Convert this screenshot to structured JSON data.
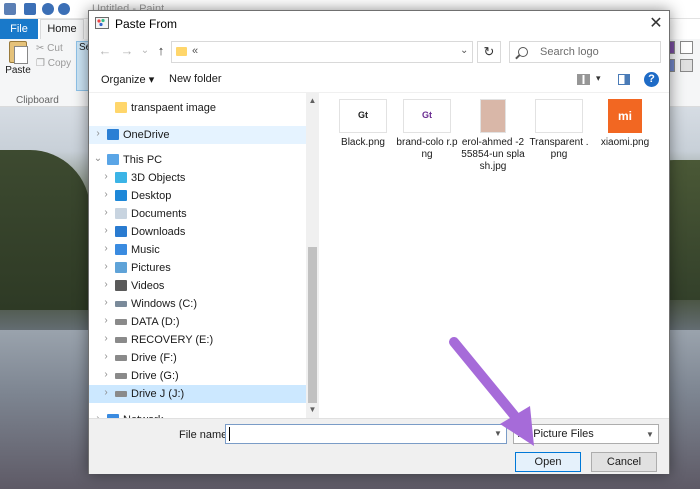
{
  "paint": {
    "window_title": "Untitled - Paint",
    "tabs": {
      "file": "File",
      "home": "Home"
    },
    "ribbon": {
      "paste_label": "Paste",
      "cut_label": "Cut",
      "copy_label": "Copy",
      "select_label": "Se",
      "clipboard_group": "Clipboard"
    },
    "swatch_colors": [
      "#cc8fb5",
      "#7a4ea1",
      "#ffffff",
      "#a9c4e6",
      "#7085c9",
      "#e0e0e0"
    ]
  },
  "dialog": {
    "title": "Paste From",
    "close_glyph": "✕",
    "nav": {
      "back": "←",
      "forward": "→",
      "recent": "⌄",
      "up": "↑"
    },
    "address": {
      "text": "«",
      "dropdown": "⌄"
    },
    "refresh_glyph": "↻",
    "search_placeholder": "Search logo",
    "toolbar": {
      "organize": "Organize ▾",
      "new_folder": "New folder",
      "help": "?"
    },
    "nav_pane": [
      {
        "label": "transpaent image",
        "icon": "folder-icon",
        "color": "#ffd66b",
        "expander": ""
      },
      {
        "label": "OneDrive",
        "icon": "onedrive-icon",
        "color": "#2b7fd4",
        "expander": "›"
      },
      {
        "label": "This PC",
        "icon": "this-pc-icon",
        "color": "#5aa5e6",
        "expander": "⌄"
      },
      {
        "label": "3D Objects",
        "icon": "3d-objects-icon",
        "color": "#3cb4e6",
        "expander": "›"
      },
      {
        "label": "Desktop",
        "icon": "desktop-icon",
        "color": "#1e88d8",
        "expander": "›"
      },
      {
        "label": "Documents",
        "icon": "documents-icon",
        "color": "#c8d4e0",
        "expander": "›"
      },
      {
        "label": "Downloads",
        "icon": "downloads-icon",
        "color": "#2a7bd0",
        "expander": "›"
      },
      {
        "label": "Music",
        "icon": "music-icon",
        "color": "#3a8be0",
        "expander": "›"
      },
      {
        "label": "Pictures",
        "icon": "pictures-icon",
        "color": "#5fa3d8",
        "expander": "›"
      },
      {
        "label": "Videos",
        "icon": "videos-icon",
        "color": "#5a5a5a",
        "expander": "›"
      },
      {
        "label": "Windows (C:)",
        "icon": "drive-icon",
        "color": "#7a8a9a",
        "expander": "›"
      },
      {
        "label": "DATA (D:)",
        "icon": "drive-icon",
        "color": "#8a8a8a",
        "expander": "›"
      },
      {
        "label": "RECOVERY (E:)",
        "icon": "drive-icon",
        "color": "#8a8a8a",
        "expander": "›"
      },
      {
        "label": "Drive (F:)",
        "icon": "drive-icon",
        "color": "#8a8a8a",
        "expander": "›"
      },
      {
        "label": "Drive (G:)",
        "icon": "drive-icon",
        "color": "#8a8a8a",
        "expander": "›"
      },
      {
        "label": "Drive J (J:)",
        "icon": "drive-icon",
        "color": "#8a8a8a",
        "expander": "›"
      },
      {
        "label": "Network",
        "icon": "network-icon",
        "color": "#3a8be0",
        "expander": "›"
      }
    ],
    "files": [
      {
        "name": "Black.png",
        "thumb_text": "Gt",
        "thumb_bg": "#ffffff",
        "thumb_fg": "#222222"
      },
      {
        "name": "brand-colo r.png",
        "thumb_text": "Gt",
        "thumb_bg": "#ffffff",
        "thumb_fg": "#6a2c91"
      },
      {
        "name": "erol-ahmed -255854-un splash.jpg",
        "thumb_text": "",
        "thumb_bg": "#d9b7a8",
        "thumb_fg": "#ffffff"
      },
      {
        "name": "Transparent .png",
        "thumb_text": "",
        "thumb_bg": "#ffffff",
        "thumb_fg": "#ffffff"
      },
      {
        "name": "xiaomi.png",
        "thumb_text": "mi",
        "thumb_bg": "#f26722",
        "thumb_fg": "#ffffff"
      }
    ],
    "footer": {
      "file_name_label": "File name:",
      "file_name_value": "",
      "file_type": "All Picture Files",
      "open": "Open",
      "cancel": "Cancel"
    }
  },
  "annotation": {
    "arrow_color": "#a66bd9"
  }
}
